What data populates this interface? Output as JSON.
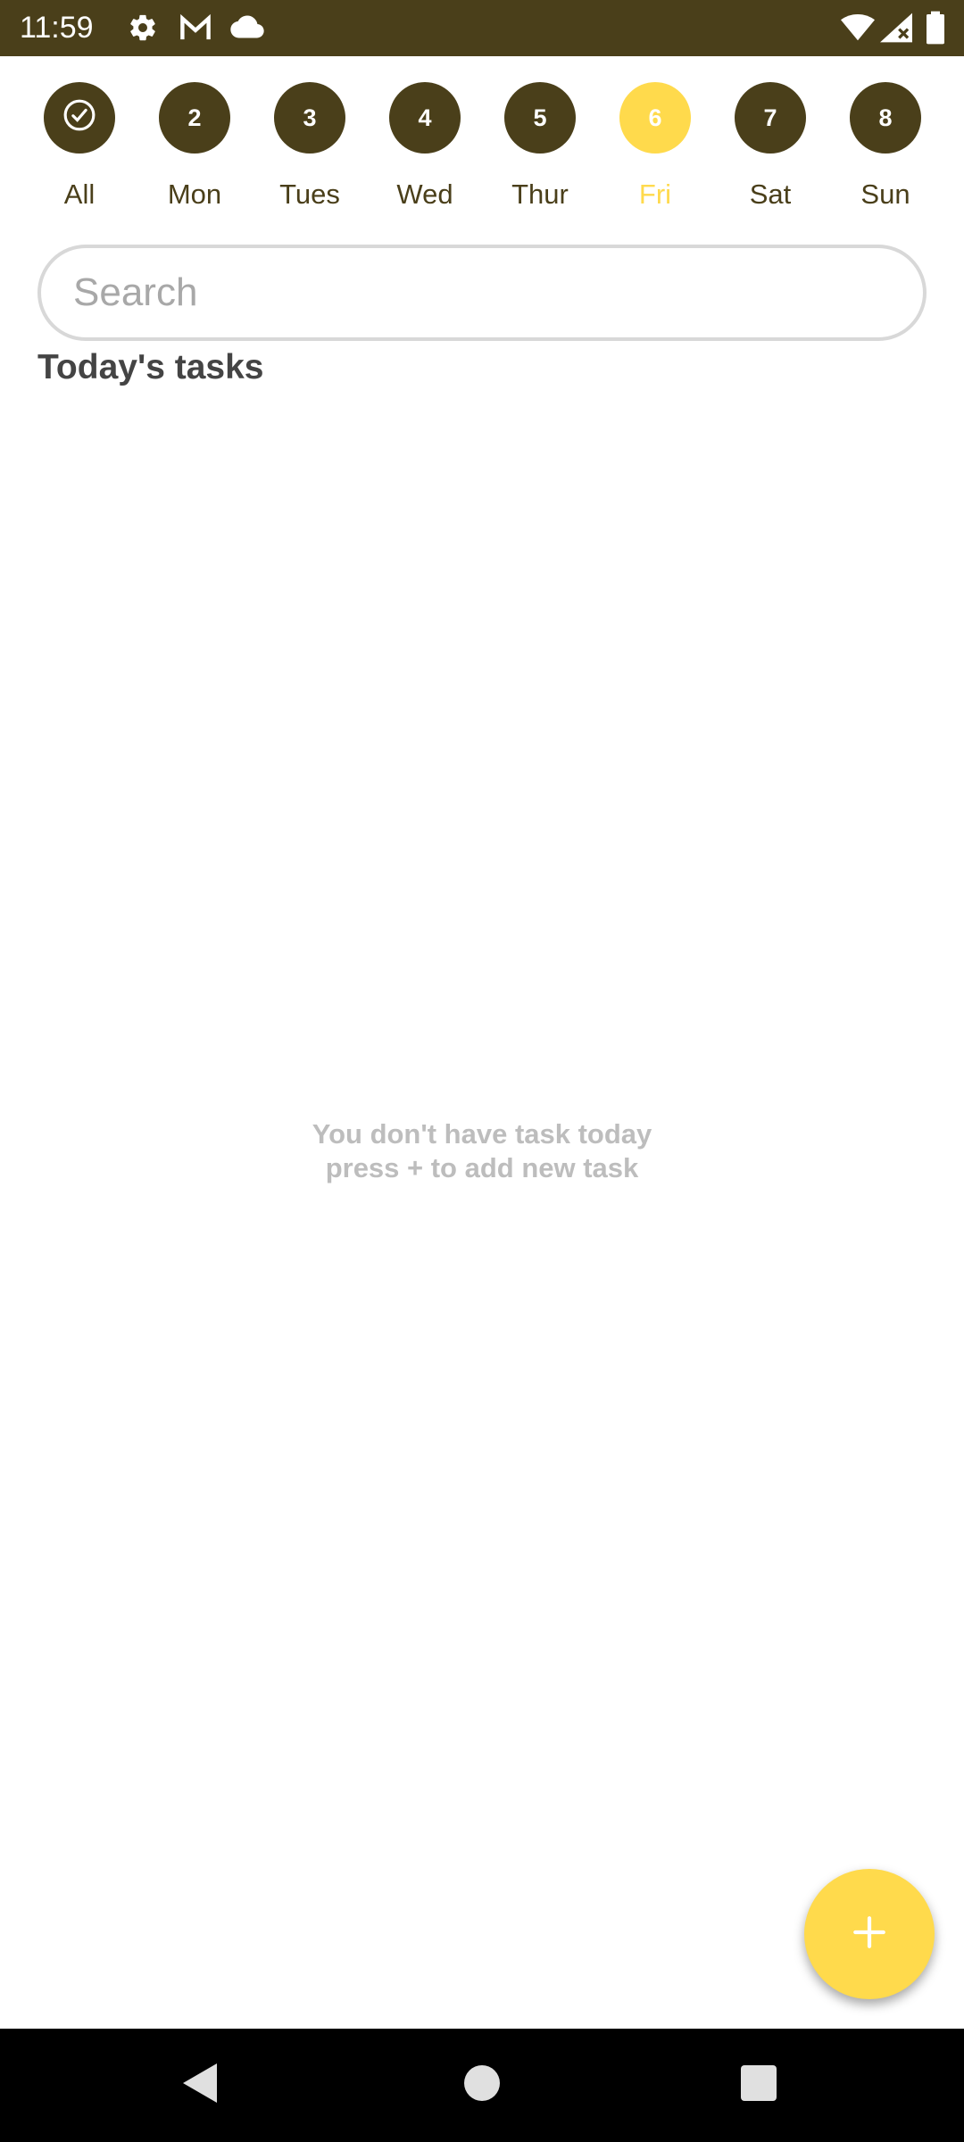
{
  "status_bar": {
    "time": "11:59",
    "icons": [
      "gear-icon",
      "gmail-icon",
      "cloud-icon",
      "wifi-icon",
      "signal-icon",
      "battery-icon"
    ]
  },
  "day_selector": {
    "days": [
      {
        "number": "",
        "icon": "check-circle-icon",
        "label": "All",
        "selected": false
      },
      {
        "number": "2",
        "label": "Mon",
        "selected": false
      },
      {
        "number": "3",
        "label": "Tues",
        "selected": false
      },
      {
        "number": "4",
        "label": "Wed",
        "selected": false
      },
      {
        "number": "5",
        "label": "Thur",
        "selected": false
      },
      {
        "number": "6",
        "label": "Fri",
        "selected": true
      },
      {
        "number": "7",
        "label": "Sat",
        "selected": false
      },
      {
        "number": "8",
        "label": "Sun",
        "selected": false
      }
    ]
  },
  "search": {
    "placeholder": "Search",
    "value": ""
  },
  "section_title": "Today's tasks",
  "empty_state": {
    "line1": "You don't have task today",
    "line2": "press + to add new task"
  },
  "fab": {
    "icon": "plus-icon"
  },
  "nav_bar": {
    "icons": [
      "back-icon",
      "home-icon",
      "recents-icon"
    ]
  },
  "colors": {
    "primary": "#4a3f1a",
    "accent": "#ffda4c",
    "muted_text": "#bdbdbd"
  }
}
